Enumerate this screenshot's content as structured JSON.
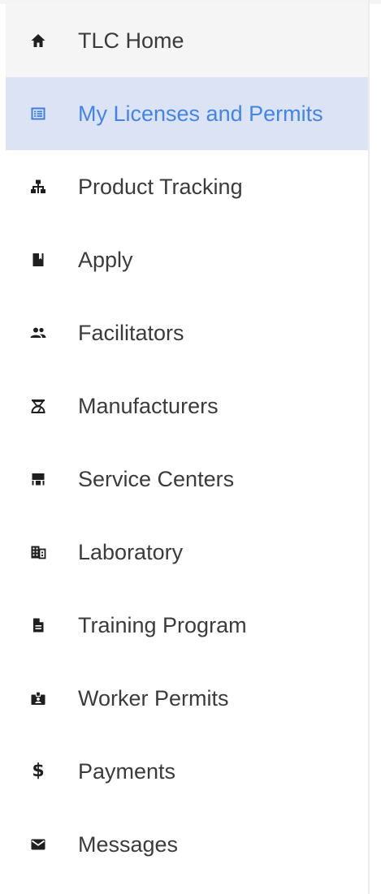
{
  "sidebar": {
    "accent_color": "#4285e8",
    "active_background": "#dbe3f5",
    "items": [
      {
        "label": "TLC Home",
        "icon": "home-icon"
      },
      {
        "label": "My Licenses and Permits",
        "icon": "list-icon",
        "active": true
      },
      {
        "label": "Product Tracking",
        "icon": "hierarchy-icon"
      },
      {
        "label": "Apply",
        "icon": "book-icon"
      },
      {
        "label": "Facilitators",
        "icon": "people-icon"
      },
      {
        "label": "Manufacturers",
        "icon": "manufacturer-icon"
      },
      {
        "label": "Service Centers",
        "icon": "store-icon"
      },
      {
        "label": "Laboratory",
        "icon": "building-icon"
      },
      {
        "label": "Training Program",
        "icon": "document-icon"
      },
      {
        "label": "Worker Permits",
        "icon": "badge-icon"
      },
      {
        "label": "Payments",
        "icon": "dollar-icon"
      },
      {
        "label": "Messages",
        "icon": "mail-icon"
      }
    ]
  }
}
